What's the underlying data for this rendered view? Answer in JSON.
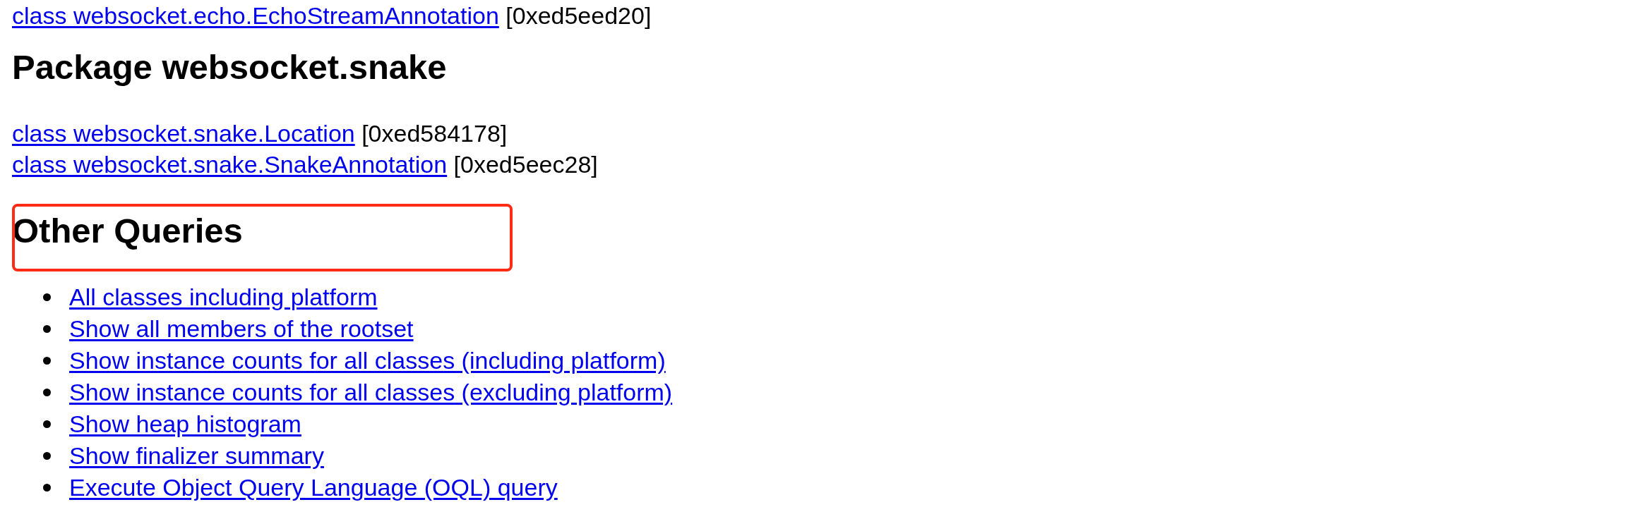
{
  "previous_package_classes": [
    {
      "name": "class websocket.echo.EchoStreamAnnotation",
      "address": "[0xed5eed20]"
    }
  ],
  "packages": [
    {
      "title": "Package websocket.snake",
      "classes": [
        {
          "name": "class websocket.snake.Location",
          "address": "[0xed584178]"
        },
        {
          "name": "class websocket.snake.SnakeAnnotation",
          "address": "[0xed5eec28]"
        }
      ]
    }
  ],
  "other_queries": {
    "title": "Other Queries",
    "highlighted": true,
    "links": [
      "All classes including platform",
      "Show all members of the rootset",
      "Show instance counts for all classes (including platform)",
      "Show instance counts for all classes (excluding platform)",
      "Show heap histogram",
      "Show finalizer summary",
      "Execute Object Query Language (OQL) query"
    ]
  }
}
